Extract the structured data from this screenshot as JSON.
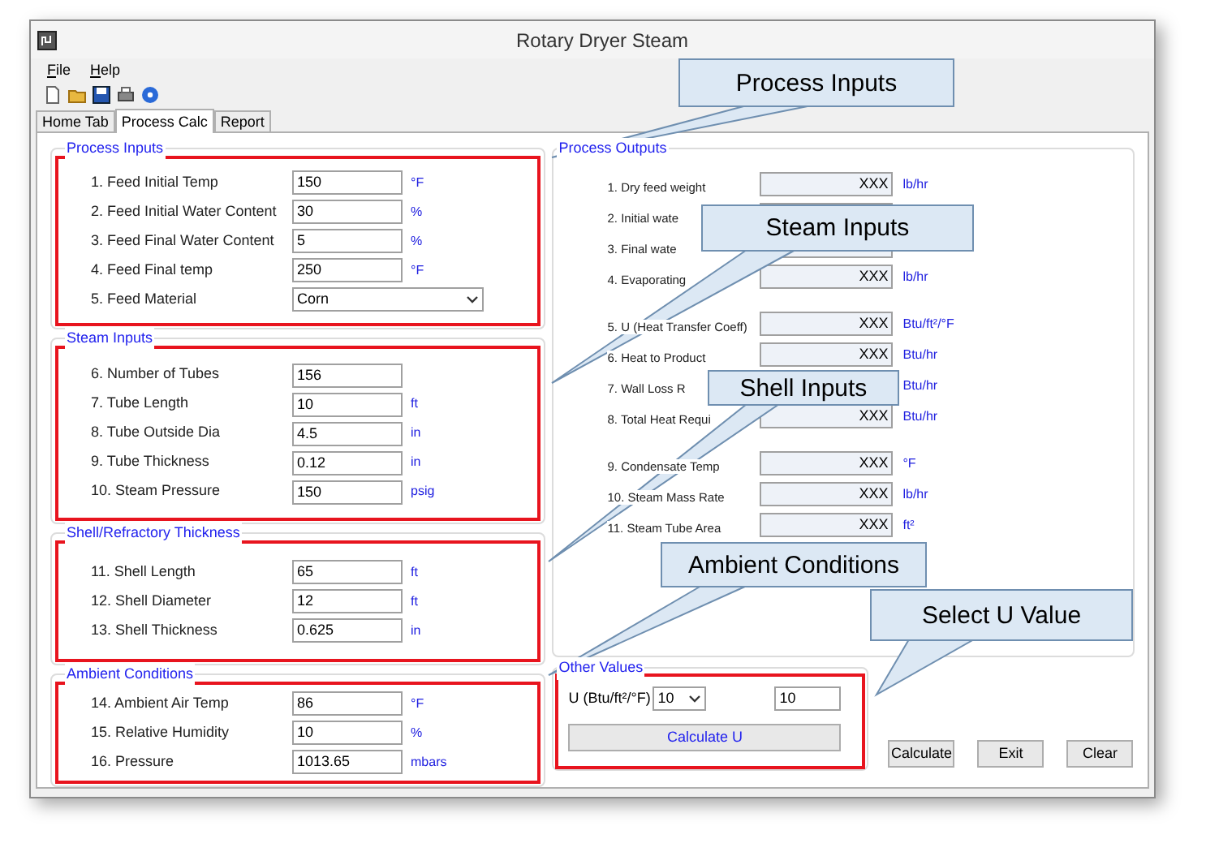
{
  "window": {
    "title": "Rotary Dryer Steam"
  },
  "menu": [
    "File",
    "Help"
  ],
  "tabs": [
    {
      "label": "Home Tab",
      "selected": false
    },
    {
      "label": "Process Calc",
      "selected": true
    },
    {
      "label": "Report",
      "selected": false
    }
  ],
  "input_groups": [
    {
      "title": "Process Inputs",
      "rows": [
        {
          "label": "1. Feed Initial Temp",
          "value": "150",
          "unit": "°F"
        },
        {
          "label": "2. Feed Initial Water Content",
          "value": "30",
          "unit": "%"
        },
        {
          "label": "3. Feed Final Water Content",
          "value": "5",
          "unit": "%"
        },
        {
          "label": "4. Feed Final temp",
          "value": "250",
          "unit": "°F"
        },
        {
          "label": "5. Feed Material",
          "value": "Corn",
          "kind": "dropdown"
        }
      ]
    },
    {
      "title": "Steam Inputs",
      "rows": [
        {
          "label": "6. Number of Tubes",
          "value": "156"
        },
        {
          "label": "7. Tube Length",
          "value": "10",
          "unit": "ft"
        },
        {
          "label": "8. Tube Outside Dia",
          "value": "4.5",
          "unit": "in"
        },
        {
          "label": "9. Tube Thickness",
          "value": "0.12",
          "unit": "in"
        },
        {
          "label": "10. Steam Pressure",
          "value": "150",
          "unit": "psig"
        }
      ]
    },
    {
      "title": "Shell/Refractory Thickness",
      "rows": [
        {
          "label": "11. Shell Length",
          "value": "65",
          "unit": "ft"
        },
        {
          "label": "12. Shell Diameter",
          "value": "12",
          "unit": "ft"
        },
        {
          "label": "13. Shell Thickness",
          "value": "0.625",
          "unit": "in"
        }
      ]
    },
    {
      "title": "Ambient Conditions",
      "rows": [
        {
          "label": "14. Ambient Air Temp",
          "value": "86",
          "unit": "°F"
        },
        {
          "label": "15. Relative Humidity",
          "value": "10",
          "unit": "%"
        },
        {
          "label": "16. Pressure",
          "value": "1013.65",
          "unit": "mbars"
        }
      ]
    }
  ],
  "process_outputs": {
    "title": "Process Outputs",
    "sections": [
      [
        {
          "label": "1. Dry feed weight",
          "value": "XXX",
          "unit": "lb/hr"
        },
        {
          "label": "2. Initial wate"
        },
        {
          "label": "3. Final wate"
        },
        {
          "label": "4. Evaporating",
          "value": "XXX",
          "unit": "lb/hr"
        }
      ],
      [
        {
          "label": "5. U (Heat Transfer Coeff)",
          "value": "XXX",
          "unit": "Btu/ft²/°F"
        },
        {
          "label": "6. Heat to Product",
          "value": "XXX",
          "unit": "Btu/hr"
        },
        {
          "label": "7. Wall Loss R",
          "unit": "Btu/hr"
        },
        {
          "label": "8. Total Heat Requi",
          "value": "XXX",
          "unit": "Btu/hr"
        }
      ],
      [
        {
          "label": "9. Condensate Temp",
          "value": "XXX",
          "unit": "°F"
        },
        {
          "label": "10. Steam Mass Rate",
          "value": "XXX",
          "unit": "lb/hr"
        },
        {
          "label": "11. Steam Tube Area",
          "value": "XXX",
          "unit": "ft²"
        }
      ]
    ]
  },
  "other_values": {
    "title": "Other Values",
    "u_label": "U (Btu/ft²/°F)",
    "u_select": "10",
    "u_value": "10",
    "button": "Calculate U"
  },
  "buttons": [
    "Calculate",
    "Exit",
    "Clear"
  ],
  "callouts": [
    "Process Inputs",
    "Steam Inputs",
    "Shell Inputs",
    "Ambient Conditions",
    "Select U Value"
  ]
}
